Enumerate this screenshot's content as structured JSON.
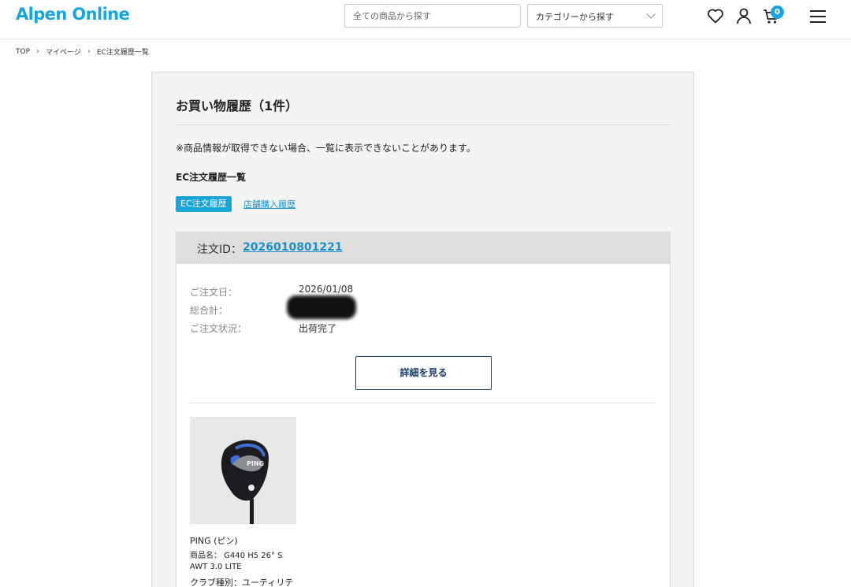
{
  "header": {
    "logo": "Alpen Online",
    "search_placeholder": "全ての商品から探す",
    "category_select": "カテゴリーから探す",
    "cart_count": "0",
    "icons": [
      "heart-icon",
      "user-icon",
      "cart-icon",
      "menu-icon"
    ]
  },
  "breadcrumb": [
    "TOP",
    "マイページ",
    "EC注文履歴一覧"
  ],
  "page": {
    "title": "お買い物履歴（1件）",
    "notice": "※商品情報が取得できない場合、一覧に表示できないことがあります。",
    "subheading": "EC注文履歴一覧",
    "tabs": {
      "active": "EC注文履歴",
      "link": "店舗購入履歴"
    }
  },
  "order": {
    "id_label": "注文ID：",
    "id": "2026010801221",
    "date_label": "ご注文日：",
    "date": "2026/01/08",
    "total_label": "総合計：",
    "status_label": "ご注文状況：",
    "status": "出荷完了",
    "detail_button": "詳細を見る",
    "product": {
      "brand": "PING (ピン)",
      "name_line1": "商品名： G440  H5 26° S",
      "name_line2": "AWT 3.0 LITE",
      "club_type": "クラブ種別：ユーティリテ",
      "head_text": "PING"
    }
  },
  "colors": {
    "brand": "#1aa5d8",
    "link": "#1a8fc9",
    "button_border": "#1b3d6b"
  }
}
